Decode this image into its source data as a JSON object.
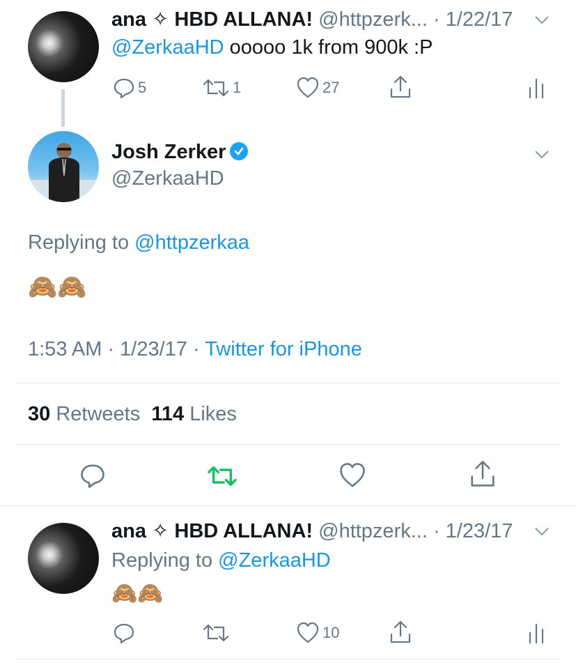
{
  "tweet1": {
    "name": "ana ✧ HBD ALLANA!",
    "handle": "@httpzerk...",
    "date": "· 1/22/17",
    "mention": "@ZerkaaHD",
    "text": "ooooo 1k from 900k :P",
    "replies": "5",
    "retweets": "1",
    "likes": "27"
  },
  "main": {
    "name": "Josh Zerker",
    "handle": "@ZerkaaHD",
    "replying_prefix": "Replying to",
    "replying_handle": "@httpzerkaa",
    "emojis": "🙈🙈",
    "time": "1:53 AM · 1/23/17 ·",
    "source": "Twitter for iPhone",
    "retweet_count": "30",
    "retweet_label": "Retweets",
    "like_count": "114",
    "like_label": "Likes"
  },
  "tweet3": {
    "name": "ana ✧ HBD ALLANA!",
    "handle": "@httpzerk...",
    "date": "· 1/23/17",
    "replying_prefix": "Replying to",
    "replying_handle": "@ZerkaaHD",
    "emojis": "🙈🙈",
    "likes": "10"
  },
  "colors": {
    "link": "#1b95e0",
    "retweet_active": "#17bf63",
    "muted": "#657786"
  }
}
